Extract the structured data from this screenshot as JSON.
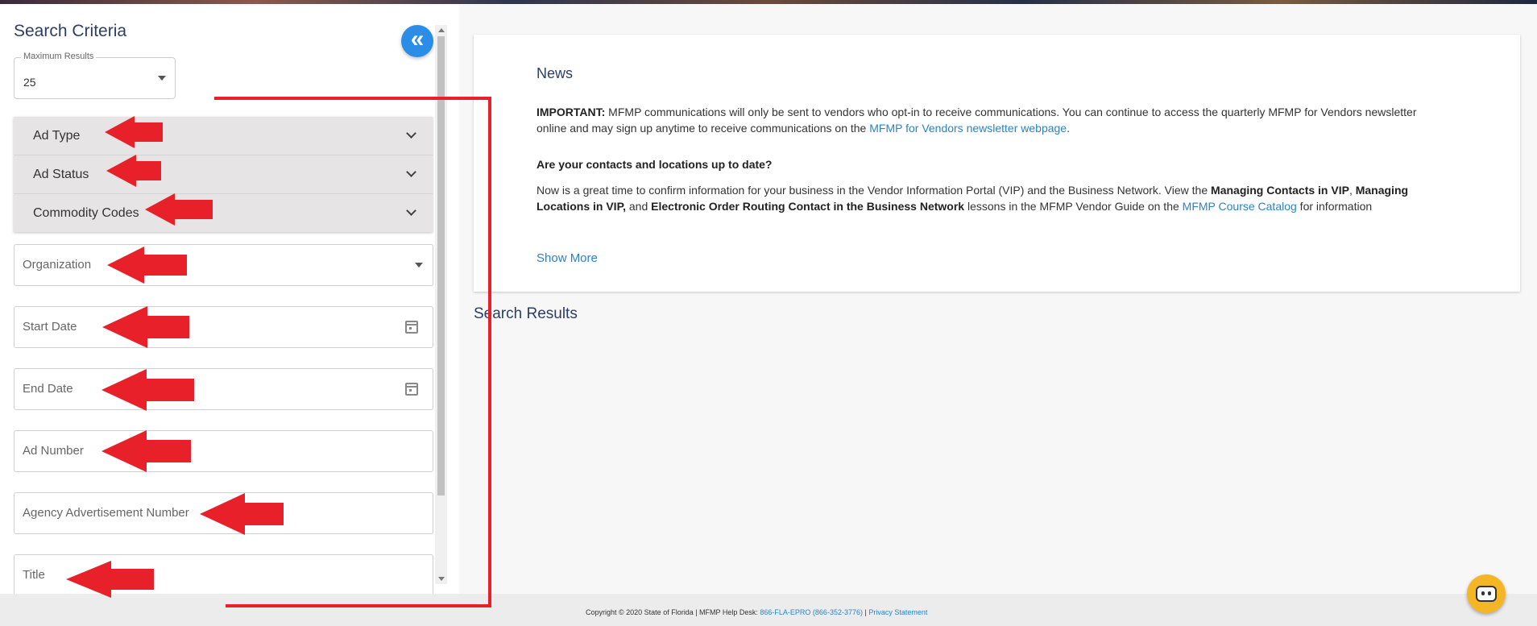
{
  "left_panel": {
    "title": "Search Criteria",
    "collapse_icon": "«",
    "max_results": {
      "label": "Maximum Results",
      "value": "25"
    },
    "accordion": [
      {
        "label": "Ad Type"
      },
      {
        "label": "Ad Status"
      },
      {
        "label": "Commodity Codes"
      }
    ],
    "fields": {
      "organization": "Organization",
      "start_date": "Start Date",
      "end_date": "End Date",
      "ad_number": "Ad Number",
      "agency_ad_number": "Agency Advertisement Number",
      "title": "Title"
    }
  },
  "news": {
    "title": "News",
    "p1": {
      "bold": "IMPORTANT:",
      "text": " MFMP communications will only be sent to vendors who opt-in to receive communications. You can continue to access the quarterly MFMP for Vendors newsletter online and may sign up anytime to receive communications on the ",
      "link": "MFMP for Vendors newsletter webpage",
      "end": "."
    },
    "heading2": "Are your contacts and locations up to date?",
    "p2": {
      "t1": "Now is a great time to confirm information for your business in the Vendor Information Portal (VIP) and the Business Network. View the ",
      "b1": "Managing Contacts in VIP",
      "t2": ", ",
      "b2": "Managing Locations in VIP,",
      "t3": " and ",
      "b3": "Electronic Order Routing Contact in the Business Network",
      "t4": " lessons in the MFMP Vendor Guide on the ",
      "link": "MFMP Course Catalog",
      "t5": " for information"
    },
    "show_more": "Show More"
  },
  "results": {
    "title": "Search Results"
  },
  "footer": {
    "copyright": "Copyright © 2020 State of Florida",
    "sep1": "  |   MFMP Help Desk: ",
    "helpdesk": "866-FLA-EPRO (866-352-3776)",
    "sep2": "  |  ",
    "privacy": "Privacy Statement"
  },
  "colors": {
    "accent_blue": "#2b8de6",
    "link_blue": "#2a83c6",
    "title_navy": "#2c3e66",
    "annotation_red": "#e8202a",
    "bot_yellow": "#f5b625"
  },
  "icons": [
    "double-chevron-left-icon",
    "chevron-down-icon",
    "caret-down-icon",
    "calendar-icon",
    "chatbot-icon",
    "red-arrow-icon"
  ]
}
